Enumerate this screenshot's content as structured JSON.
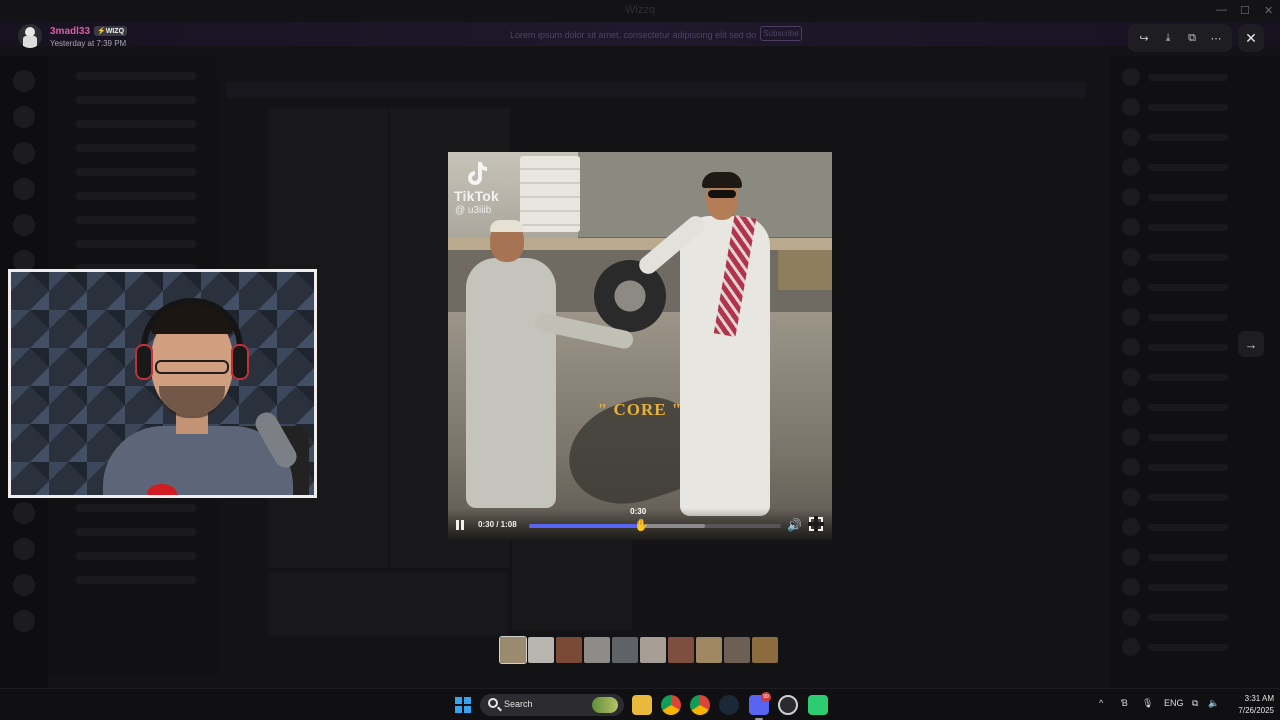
{
  "window": {
    "title": "Wizzq"
  },
  "promo": {
    "text": "Lorem ipsum dolor sit amet, consectetur adipiscing elit sed do",
    "button": "Subscribe"
  },
  "post": {
    "username": "3madl33",
    "tag": "⚡WIZQ",
    "timestamp": "Yesterday at 7:39 PM"
  },
  "viewer": {
    "actions": [
      "forward-icon",
      "download-icon",
      "open-external-icon",
      "more-icon"
    ],
    "close": "✕",
    "next": "→"
  },
  "video": {
    "watermark_brand": "TikTok",
    "watermark_handle": "@ u3iiib",
    "caption": "\" CORE \"",
    "time_current": "0:30",
    "time_total": "1:08",
    "time_readout": "0:30 / 1:08",
    "hover_time": "0:30",
    "progress": 0.4412,
    "buffered": 0.7,
    "colors": {
      "progress": "#5865f2",
      "caption": "#e6b13a"
    }
  },
  "thumbnails": [
    "#9a8b6f",
    "#b8b6ae",
    "#7a4a36",
    "#8e8b88",
    "#5f6266",
    "#a79f95",
    "#7e4f3f",
    "#a08764",
    "#6b5f56",
    "#8c6b3e"
  ],
  "taskbar": {
    "search_label": "Search",
    "apps": [
      "file-explorer-icon",
      "chrome-icon",
      "chrome-profile-icon",
      "steam-icon",
      "discord-icon",
      "obs-icon",
      "terminal-icon"
    ],
    "discord_badge": "99",
    "tray_lang": "ENG",
    "time": "3:31 AM",
    "date": "7/26/2025"
  }
}
